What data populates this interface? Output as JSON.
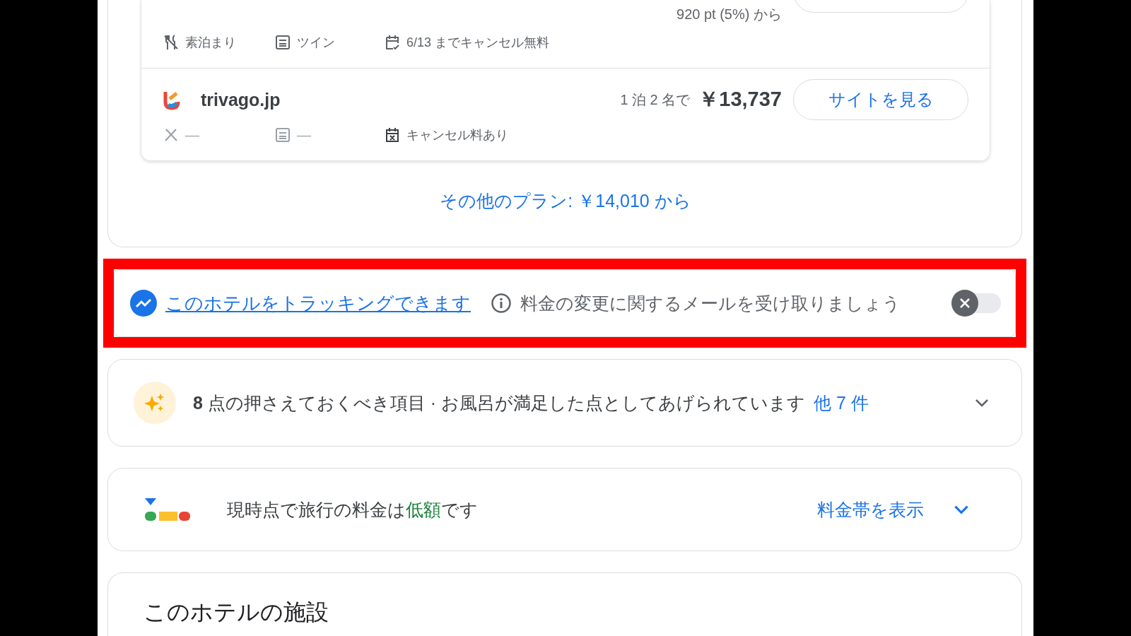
{
  "offers": [
    {
      "points": "920 pt (5%) から",
      "features": [
        {
          "kind": "meal",
          "text": "素泊まり"
        },
        {
          "kind": "room",
          "text": "ツイン"
        },
        {
          "kind": "cancel-free",
          "text": "6/13 までキャンセル無料"
        }
      ]
    },
    {
      "provider": "trivago.jp",
      "price_prefix": "1 泊 2 名で",
      "price": "￥13,737",
      "button": "サイトを見る",
      "features": [
        {
          "kind": "meal",
          "text": "––"
        },
        {
          "kind": "room",
          "text": "––"
        },
        {
          "kind": "cancel-fee",
          "text": "キャンセル料あり"
        }
      ]
    }
  ],
  "more_plans": "その他のプラン: ￥14,010 から",
  "tracking": {
    "link": "このホテルをトラッキングできます",
    "description": "料金の変更に関するメールを受け取りましょう",
    "on": false,
    "highlighted": true
  },
  "highlights": {
    "text": "**8** 点の押さえておくべき項目 · お風呂が満足した点としてあげられています",
    "more": "他 7 件",
    "expanded": false
  },
  "price_level": {
    "before": "現時点で旅行の料金は",
    "level_text": "低額",
    "after": "です",
    "link": "料金帯を表示",
    "expanded": false
  },
  "facilities": {
    "title": "このホテルの施設"
  }
}
